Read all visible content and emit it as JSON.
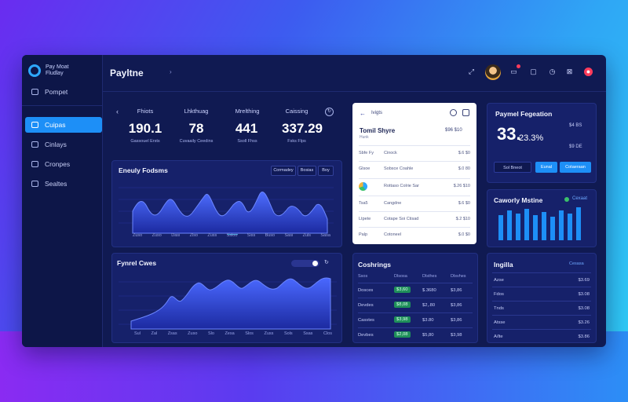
{
  "sidebar": {
    "brand_line1": "Pay Moat",
    "brand_line2": "Fludlay",
    "items": [
      {
        "label": "Pompet",
        "icon": "list-icon"
      },
      {
        "label": "Cuipas",
        "icon": "chart-icon",
        "active": true
      },
      {
        "label": "Cinlays",
        "icon": "calendar-icon"
      },
      {
        "label": "Cronpes",
        "icon": "folder-icon"
      },
      {
        "label": "Sealtes",
        "icon": "settings-icon"
      }
    ]
  },
  "topbar": {
    "title": "Payltne",
    "chevron": "›"
  },
  "stats": {
    "back": "‹",
    "items": [
      {
        "label": "Fhiots",
        "value": "190.1",
        "sub": "Gassouel Ersts"
      },
      {
        "label": "Lhkthuag",
        "value": "78",
        "sub": "Cuvaaily Ceedins"
      },
      {
        "label": "Mrelthing",
        "value": "441",
        "sub": "Ssoll Fhss"
      },
      {
        "label": "Caissing",
        "value": "337.29",
        "sub": "Fsks Flps"
      }
    ]
  },
  "fusions_chart": {
    "title": "Eneuly Fodsms",
    "tabs": [
      "Cormadey",
      "Bosias",
      "Boy"
    ],
    "ticks": [
      "Zuso",
      "Zuso",
      "Dasi",
      "Zlso",
      "Zuss",
      "Ssloo",
      "Siss",
      "Buso",
      "Sasi",
      "Zuls",
      "Sasa"
    ]
  },
  "white_card": {
    "back": "←",
    "header": "Ivigts",
    "title": "Tomil Shyre",
    "title_value": "$96 $10",
    "subtitle": "Hunk",
    "rows": [
      {
        "a": "Sbfe Fy",
        "b": "Cinock",
        "c": "$.6 $0"
      },
      {
        "a": "Glsoe",
        "b": "Sobsce\nCoahle",
        "c": "$.0 80"
      },
      {
        "a": "",
        "b": "Rottaso\nColrie Sar",
        "c": "$.26 $10"
      },
      {
        "a": "Tsa5",
        "b": "Cangdne",
        "c": "$.6 $0"
      },
      {
        "a": "Ltpete",
        "b": "Cotape Soi Ctisad",
        "c": "$.2 $10"
      },
      {
        "a": "Palp",
        "b": "Cotoneel",
        "c": "$.0 $0"
      }
    ]
  },
  "payment_card": {
    "title": "Paymel Fegeation",
    "big_value": "33.",
    "pct": "23.3%",
    "right_vals": [
      "$4 BS",
      "$9 DE"
    ],
    "buttons": [
      "Sol Bneot",
      "Eunal",
      "Cotaeraan"
    ]
  },
  "bar_card": {
    "title": "Caworly Mstine",
    "tag": "Cexaat"
  },
  "fuel_chart": {
    "title": "Fynrel Cwes",
    "ticks": [
      "Sul",
      "Zal",
      "Zsas",
      "Zuso",
      "Slo",
      "Zesa",
      "Slos",
      "Zuss",
      "Sols",
      "Ssas",
      "Clos"
    ]
  },
  "cashbox": {
    "title": "Coshrings",
    "headers": [
      "Ssos",
      "Dlsosa",
      "Dlsthes",
      "Dlsvhes"
    ],
    "rows": [
      {
        "a": "Dosces",
        "b": "$3,60",
        "c": "$.3680",
        "d": "$3,86"
      },
      {
        "a": "Devdes",
        "b": "$8,08",
        "c": "$2,.80",
        "d": "$3,86"
      },
      {
        "a": "Casstes",
        "b": "$3,98",
        "c": "$3.80",
        "d": "$3,86"
      },
      {
        "a": "Devbes",
        "b": "$2,08",
        "c": "$5,80",
        "d": "$3,98"
      }
    ]
  },
  "ingills": {
    "title": "Ingilla",
    "tag": "Cesasa",
    "rows": [
      {
        "a": "Azse",
        "b": "$3.69"
      },
      {
        "a": "Fdos",
        "b": "$3.08"
      },
      {
        "a": "Tnds",
        "b": "$3.08"
      },
      {
        "a": "Atsse",
        "b": "$3.26"
      },
      {
        "a": "A/lte",
        "b": "$3.86"
      }
    ]
  },
  "colors": {
    "accent": "#1d8ff7",
    "panel": "#16216a",
    "background": "#101a52"
  }
}
